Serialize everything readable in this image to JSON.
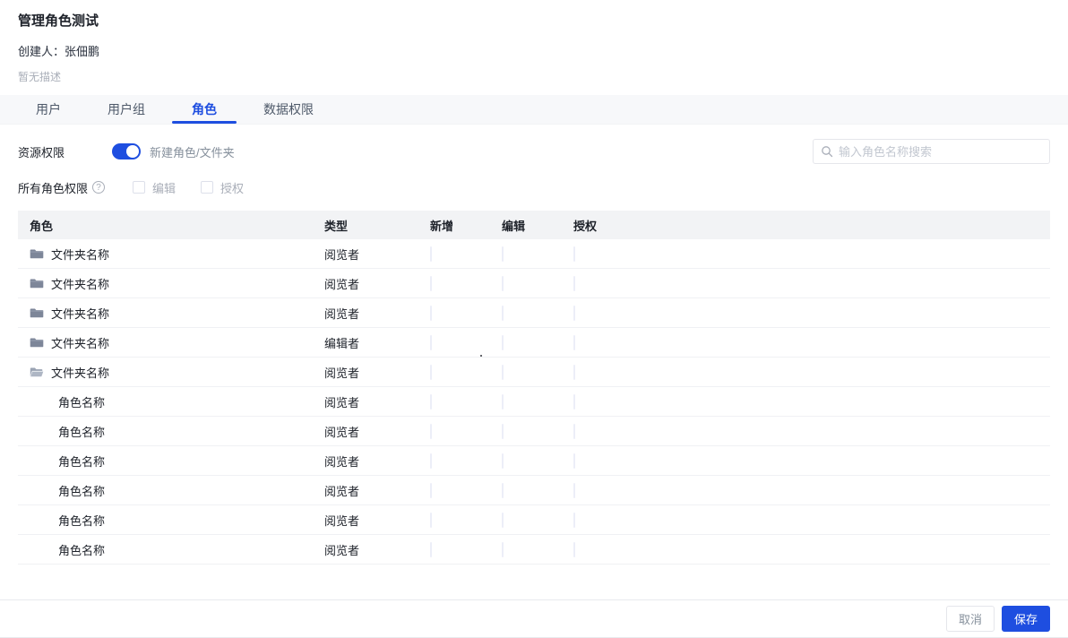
{
  "page": {
    "title": "管理角色测试",
    "creator_line": "创建人：张佃鹏",
    "description": "暂无描述"
  },
  "tabs": [
    {
      "label": "用户",
      "active": false
    },
    {
      "label": "用户组",
      "active": false
    },
    {
      "label": "角色",
      "active": true
    },
    {
      "label": "数据权限",
      "active": false
    }
  ],
  "toolbar": {
    "resource_permission_label": "资源权限",
    "toggle_state": "on",
    "new_role_folder_label": "新建角色/文件夹",
    "all_roles_label": "所有角色权限",
    "help_glyph": "?",
    "edit_checkbox": {
      "label": "编辑",
      "checked": false
    },
    "authorize_checkbox": {
      "label": "授权",
      "checked": false
    },
    "search": {
      "placeholder": "输入角色名称搜索",
      "value": "",
      "icon": "search-icon"
    }
  },
  "table": {
    "columns": [
      "角色",
      "类型",
      "新增",
      "编辑",
      "授权"
    ],
    "rows": [
      {
        "icon": "folder-closed",
        "name": "文件夹名称",
        "type": "阅览者",
        "checks": [
          false,
          false,
          false
        ]
      },
      {
        "icon": "folder-closed",
        "name": "文件夹名称",
        "type": "阅览者",
        "checks": [
          false,
          false,
          false
        ]
      },
      {
        "icon": "folder-closed",
        "name": "文件夹名称",
        "type": "阅览者",
        "checks": [
          false,
          false,
          false
        ]
      },
      {
        "icon": "folder-closed",
        "name": "文件夹名称",
        "type": "编辑者",
        "checks": [
          false,
          false,
          false
        ]
      },
      {
        "icon": "folder-open",
        "name": "文件夹名称",
        "type": "阅览者",
        "checks": [
          false,
          false,
          false
        ]
      },
      {
        "icon": "none",
        "name": "角色名称",
        "type": "阅览者",
        "checks": [
          false,
          false,
          false
        ]
      },
      {
        "icon": "none",
        "name": "角色名称",
        "type": "阅览者",
        "checks": [
          false,
          false,
          false
        ]
      },
      {
        "icon": "none",
        "name": "角色名称",
        "type": "阅览者",
        "checks": [
          false,
          false,
          false
        ]
      },
      {
        "icon": "none",
        "name": "角色名称",
        "type": "阅览者",
        "checks": [
          false,
          false,
          false
        ]
      },
      {
        "icon": "none",
        "name": "角色名称",
        "type": "阅览者",
        "checks": [
          false,
          false,
          false
        ]
      },
      {
        "icon": "none",
        "name": "角色名称",
        "type": "阅览者",
        "checks": [
          false,
          false,
          false
        ]
      }
    ]
  },
  "footer": {
    "cancel_label": "取消",
    "save_label": "保存"
  },
  "colors": {
    "primary_blue": "#1e4ee0",
    "header_bg": "#f2f3f5",
    "tabbar_bg": "#f7f8fa",
    "muted_text": "#86909c",
    "disabled_text": "#a9aeb8"
  }
}
